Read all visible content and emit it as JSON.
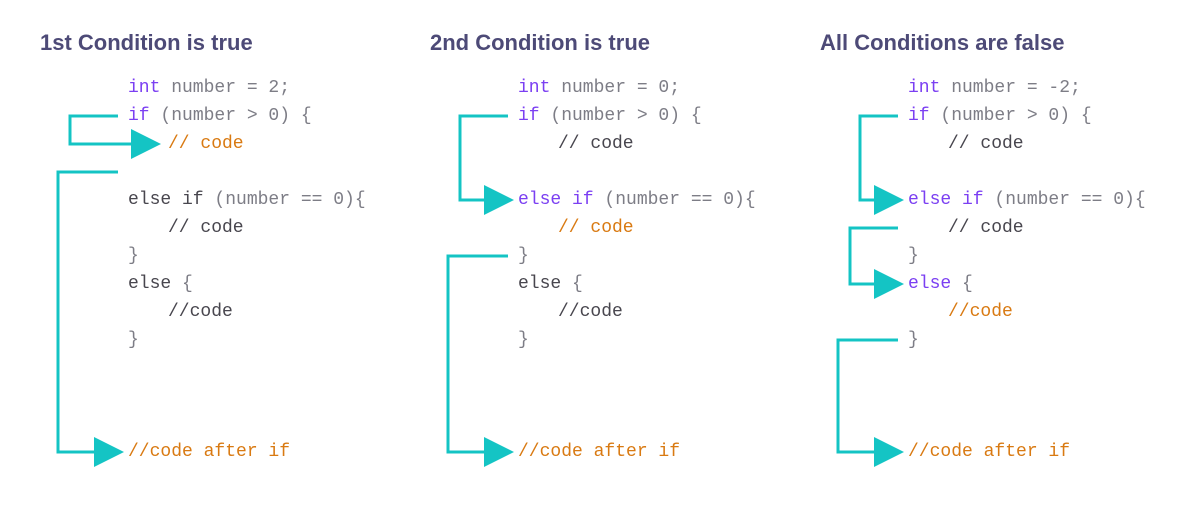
{
  "columns": [
    {
      "title": "1st Condition is true",
      "code": {
        "int": "int",
        "numDecl": " number = 2;",
        "if": "if",
        "ifCond": " (number > 0) {",
        "comment1": "// code",
        "elseif": "else if",
        "elseifCond": " (number == 0){",
        "comment2": "// code",
        "closeBrace1": "}",
        "else": "else",
        "elseOpen": " {",
        "comment3": "//code",
        "closeBrace2": "}",
        "after": "//code after if",
        "colorComment1": "cmt",
        "colorComment2": "dim",
        "colorComment3": "dim",
        "colorElseIfKw": "dim",
        "colorElseKw": "dim",
        "colorAfter": "cmt"
      }
    },
    {
      "title": "2nd Condition is true",
      "code": {
        "int": "int",
        "numDecl": " number = 0;",
        "if": "if",
        "ifCond": " (number > 0) {",
        "comment1": "// code",
        "elseif": "else if",
        "elseifCond": " (number == 0){",
        "comment2": "// code",
        "closeBrace1": "}",
        "else": "else",
        "elseOpen": " {",
        "comment3": "//code",
        "closeBrace2": "}",
        "after": "//code after if",
        "colorComment1": "dim",
        "colorComment2": "cmt",
        "colorComment3": "dim",
        "colorElseIfKw": "kw",
        "colorElseKw": "dim",
        "colorAfter": "cmt"
      }
    },
    {
      "title": "All Conditions are false",
      "code": {
        "int": "int",
        "numDecl": " number = -2;",
        "if": "if",
        "ifCond": " (number > 0) {",
        "comment1": "// code",
        "elseif": "else if",
        "elseifCond": " (number == 0){",
        "comment2": "// code",
        "closeBrace1": "}",
        "else": "else",
        "elseOpen": " {",
        "comment3": "//code",
        "closeBrace2": "}",
        "after": "//code after if",
        "colorComment1": "dim",
        "colorComment2": "dim",
        "colorComment3": "cmt",
        "colorElseIfKw": "kw",
        "colorElseKw": "kw",
        "colorAfter": "cmt"
      }
    }
  ],
  "colors": {
    "arrow": "#14c4c4"
  }
}
